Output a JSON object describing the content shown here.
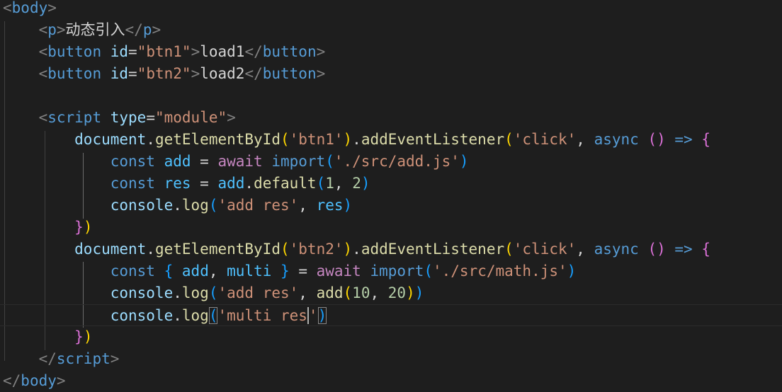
{
  "editor": {
    "language": "html",
    "colors": {
      "background": "#1e1e1e",
      "tag": "#569cd6",
      "attribute": "#9cdcfe",
      "string": "#ce9178",
      "function": "#dcdcaa",
      "keyword": "#569cd6",
      "control_keyword": "#c586c0",
      "number": "#b5cea8",
      "bracket_level_1": "#ffd700",
      "bracket_level_2": "#da70d6",
      "bracket_level_3": "#179fff"
    },
    "cursor_line": 14,
    "cursor_after_text": "multi res'",
    "lines": [
      [
        {
          "t": "<",
          "c": "tagp"
        },
        {
          "t": "body",
          "c": "tag"
        },
        {
          "t": ">",
          "c": "tagp"
        }
      ],
      [
        {
          "t": "    ",
          "c": "p"
        },
        {
          "t": "<",
          "c": "tagp"
        },
        {
          "t": "p",
          "c": "tag"
        },
        {
          "t": ">",
          "c": "tagp"
        },
        {
          "t": "动态引入",
          "c": "text"
        },
        {
          "t": "</",
          "c": "tagp"
        },
        {
          "t": "p",
          "c": "tag"
        },
        {
          "t": ">",
          "c": "tagp"
        }
      ],
      [
        {
          "t": "    ",
          "c": "p"
        },
        {
          "t": "<",
          "c": "tagp"
        },
        {
          "t": "button",
          "c": "tag"
        },
        {
          "t": " ",
          "c": "p"
        },
        {
          "t": "id",
          "c": "attr"
        },
        {
          "t": "=",
          "c": "p"
        },
        {
          "t": "\"btn1\"",
          "c": "str"
        },
        {
          "t": ">",
          "c": "tagp"
        },
        {
          "t": "load1",
          "c": "text"
        },
        {
          "t": "</",
          "c": "tagp"
        },
        {
          "t": "button",
          "c": "tag"
        },
        {
          "t": ">",
          "c": "tagp"
        }
      ],
      [
        {
          "t": "    ",
          "c": "p"
        },
        {
          "t": "<",
          "c": "tagp"
        },
        {
          "t": "button",
          "c": "tag"
        },
        {
          "t": " ",
          "c": "p"
        },
        {
          "t": "id",
          "c": "attr"
        },
        {
          "t": "=",
          "c": "p"
        },
        {
          "t": "\"btn2\"",
          "c": "str"
        },
        {
          "t": ">",
          "c": "tagp"
        },
        {
          "t": "load2",
          "c": "text"
        },
        {
          "t": "</",
          "c": "tagp"
        },
        {
          "t": "button",
          "c": "tag"
        },
        {
          "t": ">",
          "c": "tagp"
        }
      ],
      [],
      [
        {
          "t": "    ",
          "c": "p"
        },
        {
          "t": "<",
          "c": "tagp"
        },
        {
          "t": "script",
          "c": "tag"
        },
        {
          "t": " ",
          "c": "p"
        },
        {
          "t": "type",
          "c": "attr"
        },
        {
          "t": "=",
          "c": "p"
        },
        {
          "t": "\"module\"",
          "c": "str"
        },
        {
          "t": ">",
          "c": "tagp"
        }
      ],
      [
        {
          "t": "        ",
          "c": "p"
        },
        {
          "t": "document",
          "c": "var"
        },
        {
          "t": ".",
          "c": "p"
        },
        {
          "t": "getElementById",
          "c": "fn"
        },
        {
          "t": "(",
          "c": "b1"
        },
        {
          "t": "'btn1'",
          "c": "str"
        },
        {
          "t": ")",
          "c": "b1"
        },
        {
          "t": ".",
          "c": "p"
        },
        {
          "t": "addEventListener",
          "c": "fn"
        },
        {
          "t": "(",
          "c": "b1"
        },
        {
          "t": "'click'",
          "c": "str"
        },
        {
          "t": ", ",
          "c": "p"
        },
        {
          "t": "async",
          "c": "kw"
        },
        {
          "t": " ",
          "c": "p"
        },
        {
          "t": "()",
          "c": "b2"
        },
        {
          "t": " ",
          "c": "p"
        },
        {
          "t": "=>",
          "c": "kw"
        },
        {
          "t": " ",
          "c": "p"
        },
        {
          "t": "{",
          "c": "b2"
        }
      ],
      [
        {
          "t": "            ",
          "c": "p"
        },
        {
          "t": "const",
          "c": "kw"
        },
        {
          "t": " ",
          "c": "p"
        },
        {
          "t": "add",
          "c": "cvar"
        },
        {
          "t": " = ",
          "c": "p"
        },
        {
          "t": "await",
          "c": "ctl"
        },
        {
          "t": " ",
          "c": "p"
        },
        {
          "t": "import",
          "c": "kw"
        },
        {
          "t": "(",
          "c": "b3"
        },
        {
          "t": "'./src/add.js'",
          "c": "str"
        },
        {
          "t": ")",
          "c": "b3"
        }
      ],
      [
        {
          "t": "            ",
          "c": "p"
        },
        {
          "t": "const",
          "c": "kw"
        },
        {
          "t": " ",
          "c": "p"
        },
        {
          "t": "res",
          "c": "cvar"
        },
        {
          "t": " = ",
          "c": "p"
        },
        {
          "t": "add",
          "c": "cvar"
        },
        {
          "t": ".",
          "c": "p"
        },
        {
          "t": "default",
          "c": "fn"
        },
        {
          "t": "(",
          "c": "b3"
        },
        {
          "t": "1",
          "c": "num"
        },
        {
          "t": ", ",
          "c": "p"
        },
        {
          "t": "2",
          "c": "num"
        },
        {
          "t": ")",
          "c": "b3"
        }
      ],
      [
        {
          "t": "            ",
          "c": "p"
        },
        {
          "t": "console",
          "c": "var"
        },
        {
          "t": ".",
          "c": "p"
        },
        {
          "t": "log",
          "c": "fn"
        },
        {
          "t": "(",
          "c": "b3"
        },
        {
          "t": "'add res'",
          "c": "str"
        },
        {
          "t": ", ",
          "c": "p"
        },
        {
          "t": "res",
          "c": "cvar"
        },
        {
          "t": ")",
          "c": "b3"
        }
      ],
      [
        {
          "t": "        ",
          "c": "p"
        },
        {
          "t": "}",
          "c": "b2"
        },
        {
          "t": ")",
          "c": "b1"
        }
      ],
      [
        {
          "t": "        ",
          "c": "p"
        },
        {
          "t": "document",
          "c": "var"
        },
        {
          "t": ".",
          "c": "p"
        },
        {
          "t": "getElementById",
          "c": "fn"
        },
        {
          "t": "(",
          "c": "b1"
        },
        {
          "t": "'btn2'",
          "c": "str"
        },
        {
          "t": ")",
          "c": "b1"
        },
        {
          "t": ".",
          "c": "p"
        },
        {
          "t": "addEventListener",
          "c": "fn"
        },
        {
          "t": "(",
          "c": "b1"
        },
        {
          "t": "'click'",
          "c": "str"
        },
        {
          "t": ", ",
          "c": "p"
        },
        {
          "t": "async",
          "c": "kw"
        },
        {
          "t": " ",
          "c": "p"
        },
        {
          "t": "()",
          "c": "b2"
        },
        {
          "t": " ",
          "c": "p"
        },
        {
          "t": "=>",
          "c": "kw"
        },
        {
          "t": " ",
          "c": "p"
        },
        {
          "t": "{",
          "c": "b2"
        }
      ],
      [
        {
          "t": "            ",
          "c": "p"
        },
        {
          "t": "const",
          "c": "kw"
        },
        {
          "t": " ",
          "c": "p"
        },
        {
          "t": "{",
          "c": "b3"
        },
        {
          "t": " ",
          "c": "p"
        },
        {
          "t": "add",
          "c": "cvar"
        },
        {
          "t": ", ",
          "c": "p"
        },
        {
          "t": "multi",
          "c": "cvar"
        },
        {
          "t": " ",
          "c": "p"
        },
        {
          "t": "}",
          "c": "b3"
        },
        {
          "t": " = ",
          "c": "p"
        },
        {
          "t": "await",
          "c": "ctl"
        },
        {
          "t": " ",
          "c": "p"
        },
        {
          "t": "import",
          "c": "kw"
        },
        {
          "t": "(",
          "c": "b3"
        },
        {
          "t": "'./src/math.js'",
          "c": "str"
        },
        {
          "t": ")",
          "c": "b3"
        }
      ],
      [
        {
          "t": "            ",
          "c": "p"
        },
        {
          "t": "console",
          "c": "var"
        },
        {
          "t": ".",
          "c": "p"
        },
        {
          "t": "log",
          "c": "fn"
        },
        {
          "t": "(",
          "c": "b3"
        },
        {
          "t": "'add res'",
          "c": "str"
        },
        {
          "t": ", ",
          "c": "p"
        },
        {
          "t": "add",
          "c": "fn"
        },
        {
          "t": "(",
          "c": "b1"
        },
        {
          "t": "10",
          "c": "num"
        },
        {
          "t": ", ",
          "c": "p"
        },
        {
          "t": "20",
          "c": "num"
        },
        {
          "t": ")",
          "c": "b1"
        },
        {
          "t": ")",
          "c": "b3"
        }
      ],
      [
        {
          "t": "            ",
          "c": "p"
        },
        {
          "t": "console",
          "c": "var"
        },
        {
          "t": ".",
          "c": "p"
        },
        {
          "t": "log",
          "c": "fn"
        },
        {
          "t": "(",
          "c": "b3",
          "m": true
        },
        {
          "t": "'multi res",
          "c": "str"
        },
        {
          "cursor": true
        },
        {
          "t": "'",
          "c": "str"
        },
        {
          "t": ")",
          "c": "b3",
          "m": true
        }
      ],
      [
        {
          "t": "        ",
          "c": "p"
        },
        {
          "t": "}",
          "c": "b2"
        },
        {
          "t": ")",
          "c": "b1"
        }
      ],
      [
        {
          "t": "    ",
          "c": "p"
        },
        {
          "t": "</",
          "c": "tagp"
        },
        {
          "t": "script",
          "c": "tag"
        },
        {
          "t": ">",
          "c": "tagp"
        }
      ],
      [
        {
          "t": "</",
          "c": "tagp"
        },
        {
          "t": "body",
          "c": "tag"
        },
        {
          "t": ">",
          "c": "tagp"
        }
      ]
    ]
  }
}
